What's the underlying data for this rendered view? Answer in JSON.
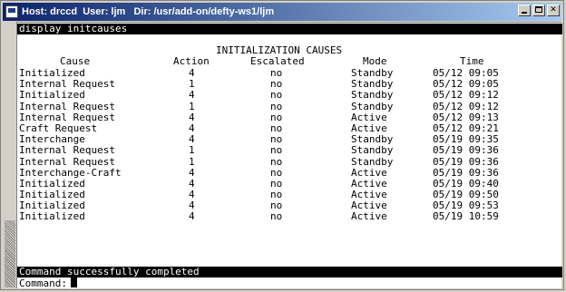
{
  "window": {
    "title": "Host: drccd  User: ljm   Dir: /usr/add-on/defty-ws1/ljm"
  },
  "terminal": {
    "command": "display initcauses",
    "report_title": "INITIALIZATION CAUSES",
    "columns": {
      "cause": "Cause",
      "action": "Action",
      "escalated": "Escalated",
      "mode": "Mode",
      "time": "Time"
    },
    "rows": [
      {
        "cause": "Initialized",
        "action": "4",
        "escalated": "no",
        "mode": "Standby",
        "time": "05/12 09:05"
      },
      {
        "cause": "Internal Request",
        "action": "1",
        "escalated": "no",
        "mode": "Standby",
        "time": "05/12 09:05"
      },
      {
        "cause": "Initialized",
        "action": "4",
        "escalated": "no",
        "mode": "Standby",
        "time": "05/12 09:12"
      },
      {
        "cause": "Internal Request",
        "action": "1",
        "escalated": "no",
        "mode": "Standby",
        "time": "05/12 09:12"
      },
      {
        "cause": "Internal Request",
        "action": "4",
        "escalated": "no",
        "mode": "Active",
        "time": "05/12 09:13"
      },
      {
        "cause": "Craft Request",
        "action": "4",
        "escalated": "no",
        "mode": "Active",
        "time": "05/12 09:21"
      },
      {
        "cause": "Interchange",
        "action": "4",
        "escalated": "no",
        "mode": "Standby",
        "time": "05/19 09:35"
      },
      {
        "cause": "Internal Request",
        "action": "1",
        "escalated": "no",
        "mode": "Standby",
        "time": "05/19 09:36"
      },
      {
        "cause": "Internal Request",
        "action": "1",
        "escalated": "no",
        "mode": "Standby",
        "time": "05/19 09:36"
      },
      {
        "cause": "Interchange-Craft",
        "action": "4",
        "escalated": "no",
        "mode": "Active",
        "time": "05/19 09:36"
      },
      {
        "cause": "Initialized",
        "action": "4",
        "escalated": "no",
        "mode": "Active",
        "time": "05/19 09:40"
      },
      {
        "cause": "Initialized",
        "action": "4",
        "escalated": "no",
        "mode": "Active",
        "time": "05/19 09:50"
      },
      {
        "cause": "Initialized",
        "action": "4",
        "escalated": "no",
        "mode": "Active",
        "time": "05/19 09:53"
      },
      {
        "cause": "Initialized",
        "action": "4",
        "escalated": "no",
        "mode": "Active",
        "time": "05/19 10:59"
      }
    ],
    "status": "Command successfully completed",
    "prompt": "Command:"
  }
}
